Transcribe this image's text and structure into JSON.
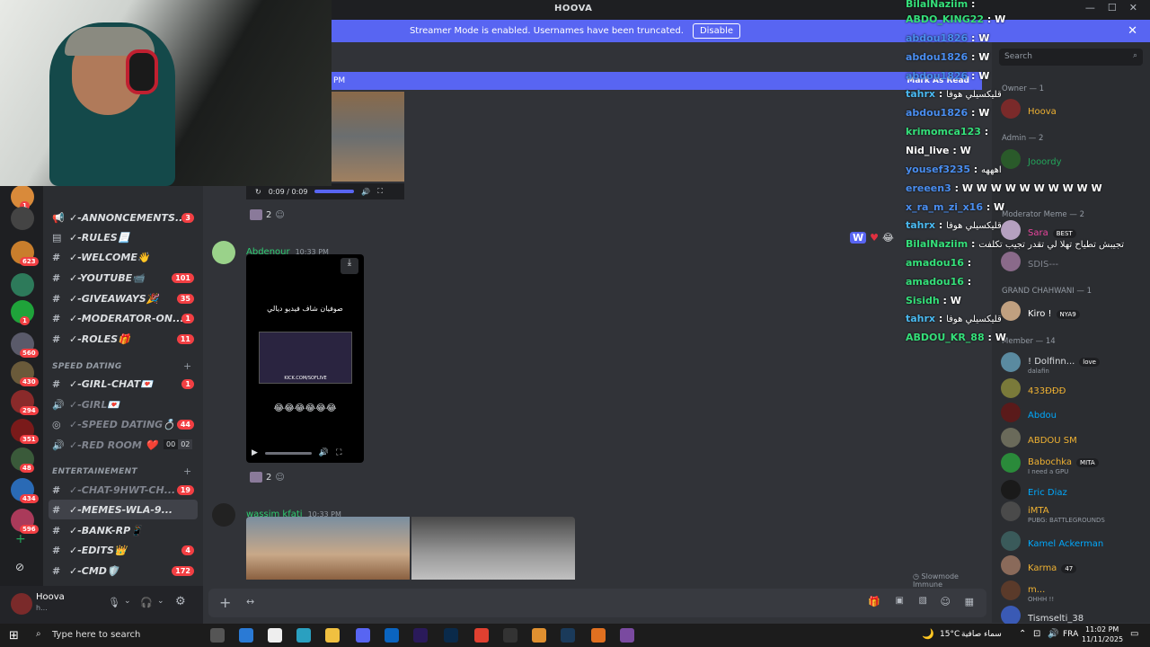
{
  "app": {
    "title": "HOOVA"
  },
  "banner": {
    "text": "Streamer Mode is enabled. Usernames have been truncated.",
    "button": "Disable"
  },
  "new_bar": {
    "left": "PM",
    "right": "Mark As Read"
  },
  "servers": [
    {
      "badge": "1",
      "color": "#d98a3a"
    },
    {
      "badge": "",
      "color": "#444"
    },
    {
      "badge": "623",
      "color": "#c97e2c"
    },
    {
      "badge": "",
      "color": "#2d7a5a"
    },
    {
      "badge": "1",
      "color": "#1fa33a"
    },
    {
      "badge": "560",
      "color": "#5a5a6a"
    },
    {
      "badge": "430",
      "color": "#6a5a3a"
    },
    {
      "badge": "294",
      "color": "#8a2a2a"
    },
    {
      "badge": "351",
      "color": "#7a1a1a"
    },
    {
      "badge": "48",
      "color": "#3a5a3a"
    },
    {
      "badge": "434",
      "color": "#2a6ab5"
    },
    {
      "badge": "596",
      "color": "#aa3a5a"
    }
  ],
  "channels": [
    {
      "icon": "📢",
      "name": "✓-ANNONCEMENTS...",
      "count": "3",
      "muted": false
    },
    {
      "icon": "▤",
      "name": "✓-RULES📃",
      "count": "",
      "muted": false
    },
    {
      "icon": "#",
      "name": "✓-WELCOME👋",
      "count": "",
      "muted": false
    },
    {
      "icon": "#",
      "name": "✓-YOUTUBE📹",
      "count": "101",
      "muted": false
    },
    {
      "icon": "#",
      "name": "✓-GIVEAWAYS🎉",
      "count": "35",
      "muted": false
    },
    {
      "icon": "#",
      "name": "✓-MODERATOR-ON...",
      "count": "1",
      "muted": false
    },
    {
      "icon": "#",
      "name": "✓-ROLES🎁",
      "count": "11",
      "muted": false
    }
  ],
  "cat1": "SPEED DATING",
  "channels2": [
    {
      "icon": "#",
      "name": "✓-GIRL-CHAT💌",
      "count": "1",
      "muted": false
    },
    {
      "icon": "🔊",
      "name": "✓-GIRL💌",
      "count": "",
      "muted": true
    },
    {
      "icon": "◎",
      "name": "✓-SPEED DATING💍",
      "count": "44",
      "muted": true
    },
    {
      "icon": "🔊",
      "name": "✓-RED ROOM ❤️",
      "count": "",
      "muted": true
    }
  ],
  "redroom_counts": [
    "00",
    "02"
  ],
  "cat2": "ENTERTAINEMENT",
  "channels3": [
    {
      "icon": "#",
      "name": "✓-CHAT-9HWT-CH...",
      "count": "19",
      "muted": true
    },
    {
      "icon": "#",
      "name": "✓-MEMES-WLA-9...",
      "count": "",
      "muted": false
    },
    {
      "icon": "#",
      "name": "✓-BANK-RP📱",
      "count": "",
      "muted": false
    },
    {
      "icon": "#",
      "name": "✓-EDITS👑",
      "count": "4",
      "muted": false
    },
    {
      "icon": "#",
      "name": "✓-CMD🛡️",
      "count": "172",
      "muted": false
    }
  ],
  "user": {
    "name": "Hoova",
    "status": "h..."
  },
  "video1": {
    "time": "0:09 / 0:09",
    "reactions": "2"
  },
  "msg1": {
    "author": "Abdenour",
    "time": "10:33 PM",
    "video_text": "صوفيان شاف فيديو ديالي",
    "url": "KICK.COM/SOFLIVE",
    "emojis": "😂😂😂😂😂😂",
    "reactions": "2"
  },
  "msg2": {
    "author": "wassim kfati",
    "time": "10:33 PM"
  },
  "slowmode": "Slowmode Immune",
  "members": {
    "search": "Search",
    "owner_header": "Owner — 1",
    "admin_header": "Admin — 2",
    "mod_header": "Moderator Meme — 2",
    "gc_header": "GRAND CHAHWANI — 1",
    "member_header": "Member — 14",
    "list": [
      {
        "name": "Hoova",
        "sub": "",
        "color": "#f0b232",
        "av": "#7a2a2a"
      },
      {
        "name": "Jooordy",
        "sub": "",
        "color": "#23a55a",
        "av": "#2a5a2a"
      },
      {
        "name": "Sara",
        "sub": "",
        "tag": "BEST",
        "color": "#eb459e",
        "av": "#b5a0c0"
      },
      {
        "name": "SDIS---",
        "sub": "",
        "color": "#80848e",
        "av": "#8a6a8a"
      },
      {
        "name": "Kiro !",
        "sub": "",
        "tag": "NYA9",
        "color": "#fff",
        "av": "#c0a080"
      },
      {
        "name": "! Dolfinn...",
        "sub": "dalafin",
        "tag": "love",
        "color": "#dbdee1",
        "av": "#5a8aa0"
      },
      {
        "name": "433ƉƉƉ",
        "sub": "",
        "color": "#f0b232",
        "av": "#7a7a3a"
      },
      {
        "name": "Abdou",
        "sub": "",
        "color": "#00a8fc",
        "av": "#5a1a1a"
      },
      {
        "name": "ABDOU SM",
        "sub": "",
        "color": "#f0b232",
        "av": "#6a6a5a"
      },
      {
        "name": "Babochka",
        "sub": "I need a GPU",
        "tag": "MITA",
        "color": "#f0b232",
        "av": "#2a8a3a"
      },
      {
        "name": "Eric Diaz",
        "sub": "",
        "color": "#00a8fc",
        "av": "#1a1a1a"
      },
      {
        "name": "iMTA",
        "sub": "PUBG: BATTLEGROUNDS",
        "color": "#f0b232",
        "av": "#4a4a4a"
      },
      {
        "name": "Kamel Ackerman",
        "sub": "",
        "color": "#00a8fc",
        "av": "#3a5a5a"
      },
      {
        "name": "Karma",
        "sub": "",
        "tag": "47",
        "color": "#f0b232",
        "av": "#8a6a5a"
      },
      {
        "name": "m...",
        "sub": "OHHH !!",
        "color": "#f0b232",
        "av": "#5a3a2a"
      },
      {
        "name": "Tismselti_38",
        "sub": "",
        "color": "#dbdee1",
        "av": "#3a5ab5"
      }
    ]
  },
  "overlay": [
    {
      "user": "BilalNaziim",
      "text": "",
      "color": "#35e07a"
    },
    {
      "user": "ABDO_KING22",
      "text": "W",
      "color": "#35e07a"
    },
    {
      "user": "abdou1826",
      "text": "W",
      "color": "#4a8ef0"
    },
    {
      "user": "abdou1826",
      "text": "W",
      "color": "#4a8ef0"
    },
    {
      "user": "abdou1826",
      "text": "W",
      "color": "#4a8ef0"
    },
    {
      "user": "tahrx",
      "text": "قليكسيلي هوفا",
      "color": "#4ab9f0"
    },
    {
      "user": "abdou1826",
      "text": "W",
      "color": "#4a8ef0"
    },
    {
      "user": "krimomca123",
      "text": "",
      "color": "#35e07a"
    },
    {
      "user": "Nid_live",
      "text": "W",
      "color": "#fff"
    },
    {
      "user": "yousef3235",
      "text": "اهههه",
      "color": "#4a8ef0"
    },
    {
      "user": "ereeen3",
      "text": "W W W W W W W W W W",
      "color": "#4a8ef0"
    },
    {
      "user": "x_ra_m_zi_x16",
      "text": "W",
      "color": "#4a8ef0"
    },
    {
      "user": "tahrx",
      "text": "قليكسيلي هوفا",
      "color": "#4ab9f0"
    },
    {
      "user": "BilalNaziim",
      "text": "تجيبش تطياح تهلا لي تقدر تجيب تكلفت",
      "color": "#35e07a"
    },
    {
      "user": "amadou16",
      "text": "",
      "color": "#35e07a"
    },
    {
      "user": "amadou16",
      "text": "",
      "color": "#35e07a"
    },
    {
      "user": "Sisidh",
      "text": "W",
      "color": "#35e07a"
    },
    {
      "user": "tahrx",
      "text": "قليكسيلي هوفا",
      "color": "#4ab9f0"
    },
    {
      "user": "ABDOU_KR_88",
      "text": "W",
      "color": "#35e07a"
    }
  ],
  "taskbar": {
    "search": "Type here to search",
    "temp": "15°C",
    "weather": "سماء صافية",
    "lang": "FRA",
    "time": "11:02 PM",
    "date": "11/11/2025"
  }
}
